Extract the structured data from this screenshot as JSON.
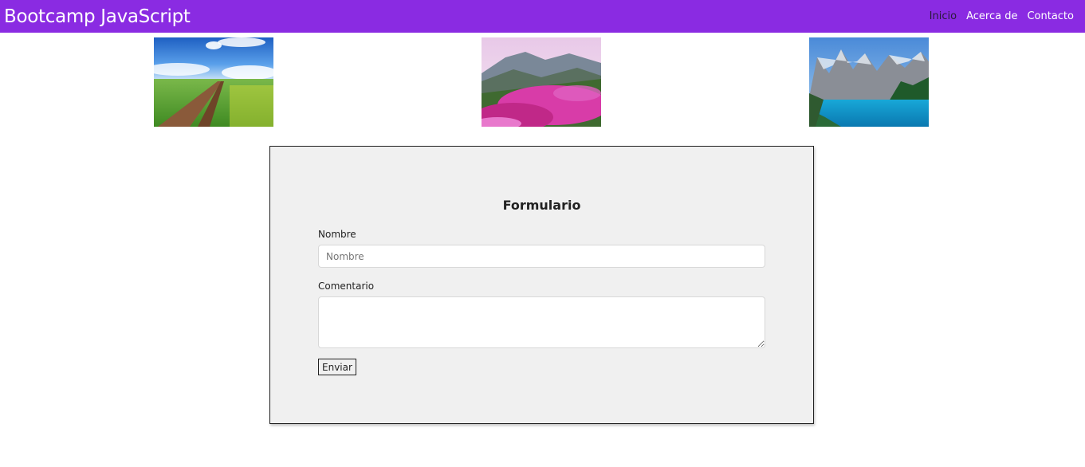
{
  "navbar": {
    "brand": "Bootcamp JavaScript",
    "links": [
      {
        "label": "Inicio",
        "active": true
      },
      {
        "label": "Acerca de",
        "active": false
      },
      {
        "label": "Contacto",
        "active": false
      }
    ],
    "bg_color": "#8a2be2"
  },
  "gallery": {
    "images": [
      {
        "subject": "green field with dirt path under blue sky"
      },
      {
        "subject": "pink wildflowers in mountain meadow"
      },
      {
        "subject": "turquoise lake with rocky mountains"
      }
    ]
  },
  "form": {
    "title": "Formulario",
    "name_label": "Nombre",
    "name_placeholder": "Nombre",
    "name_value": "",
    "comment_label": "Comentario",
    "comment_value": "",
    "submit_label": "Enviar"
  }
}
